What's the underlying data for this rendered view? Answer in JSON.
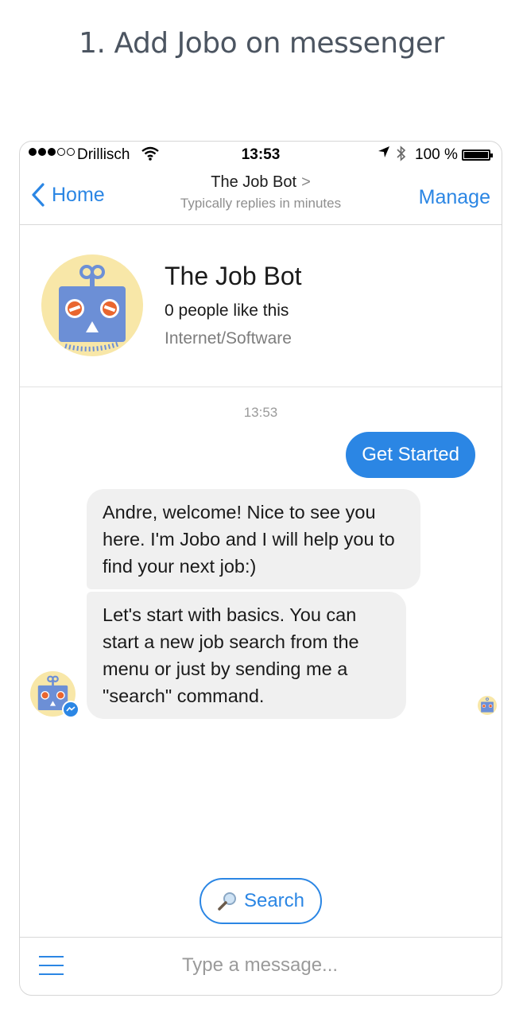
{
  "heading": "1. Add Jobo on messenger",
  "status_bar": {
    "carrier": "Drillisch",
    "time": "13:53",
    "battery": "100 %"
  },
  "nav": {
    "back_label": "Home",
    "title": "The Job Bot",
    "subtitle": "Typically replies in minutes",
    "manage_label": "Manage"
  },
  "profile": {
    "name": "The Job Bot",
    "likes": "0 people like this",
    "category": "Internet/Software"
  },
  "chat": {
    "timestamp": "13:53",
    "user_message": "Get Started",
    "bot_messages": [
      "Andre, welcome! Nice to see you here. I'm Jobo and I will help you to find your next job:)",
      "Let's start with basics. You can start a new job search from the menu or just by sending me a \"search\" command."
    ]
  },
  "quick_reply": {
    "icon": "magnifier-icon",
    "label": "Search"
  },
  "composer": {
    "placeholder": "Type a message..."
  },
  "colors": {
    "accent": "#2b86e4",
    "bubble_gray": "#f0f0f0",
    "robot_blue": "#6c8fd6",
    "avatar_bg": "#f8e7a8"
  }
}
